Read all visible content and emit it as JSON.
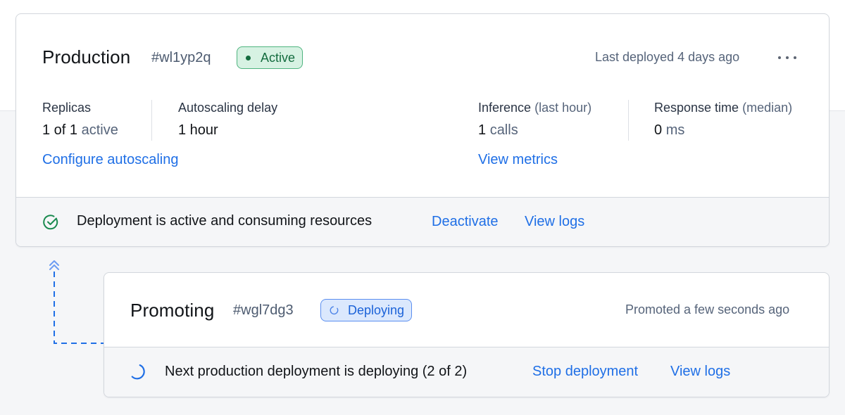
{
  "production": {
    "title": "Production",
    "id": "#wl1yp2q",
    "status_badge": "Active",
    "last_deployed": "Last deployed 4 days ago",
    "more_icon": "more-horizontal-icon",
    "stats": {
      "replicas": {
        "label": "Replicas",
        "value": "1 of 1",
        "unit": "active"
      },
      "autoscaling_delay": {
        "label": "Autoscaling delay",
        "value": "1 hour"
      },
      "inference": {
        "label": "Inference",
        "sub": "(last hour)",
        "value": "1",
        "unit": "calls"
      },
      "response_time": {
        "label": "Response time",
        "sub": "(median)",
        "value": "0",
        "unit": "ms"
      }
    },
    "links": {
      "configure_autoscaling": "Configure autoscaling",
      "view_metrics": "View metrics"
    },
    "footer": {
      "icon": "check-circle-icon",
      "message": "Deployment is active and consuming resources",
      "deactivate": "Deactivate",
      "view_logs": "View logs"
    },
    "colors": {
      "success": "#146c3f",
      "link": "#1f6fe6"
    }
  },
  "promoting": {
    "title": "Promoting",
    "id": "#wgl7dg3",
    "status_badge": "Deploying",
    "promoted": "Promoted a few seconds ago",
    "footer": {
      "icon": "spinner-icon",
      "message": "Next production deployment is deploying (2 of 2)",
      "stop_deployment": "Stop deployment",
      "view_logs": "View logs"
    },
    "colors": {
      "info": "#1b62d8"
    }
  },
  "connector": {
    "icon": "chevrons-up-icon"
  }
}
